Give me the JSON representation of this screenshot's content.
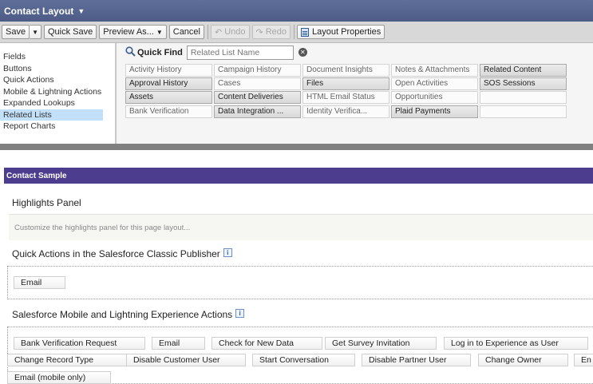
{
  "header": {
    "title": "Contact Layout"
  },
  "toolbar": {
    "save": "Save",
    "quick_save": "Quick Save",
    "preview_as": "Preview As...",
    "cancel": "Cancel",
    "undo": "Undo",
    "redo": "Redo",
    "layout_properties": "Layout Properties"
  },
  "palette": {
    "categories": [
      "Fields",
      "Buttons",
      "Quick Actions",
      "Mobile & Lightning Actions",
      "Expanded Lookups",
      "Related Lists",
      "Report Charts"
    ],
    "selected_category": "Related Lists",
    "quick_find": {
      "label": "Quick Find",
      "placeholder": "Related List Name"
    },
    "items": [
      [
        "Activity History",
        "Campaign History",
        "Document Insights",
        "Notes & Attachments",
        "Related Content"
      ],
      [
        "Approval History",
        "Cases",
        "Files",
        "Open Activities",
        "SOS Sessions"
      ],
      [
        "Assets",
        "Content Deliveries",
        "HTML Email Status",
        "Opportunities",
        ""
      ],
      [
        "Bank Verification",
        "Data Integration ...",
        "Identity Verifica...",
        "Plaid Payments",
        ""
      ]
    ],
    "active_items": [
      [
        false,
        false,
        false,
        false,
        true
      ],
      [
        true,
        false,
        true,
        false,
        true
      ],
      [
        true,
        true,
        false,
        false,
        false
      ],
      [
        false,
        true,
        false,
        true,
        false
      ]
    ]
  },
  "sample": {
    "bar_title": "Contact Sample",
    "highlights_title": "Highlights Panel",
    "highlights_hint": "Customize the highlights panel for this page layout...",
    "classic_title": "Quick Actions in the Salesforce Classic Publisher",
    "classic_actions": [
      "Email"
    ],
    "mobile_title": "Salesforce Mobile and Lightning Experience Actions",
    "mobile_actions": [
      [
        "Bank Verification Request",
        "Email",
        "Check for New Data",
        "Get Survey Invitation",
        "Log in to Experience as User",
        ""
      ],
      [
        "Change Record Type",
        "Disable Customer User",
        "Start Conversation",
        "Disable Partner User",
        "Change Owner",
        "En"
      ],
      [
        "Email (mobile only)"
      ]
    ]
  },
  "colors": {
    "title_bar": "#4c5c86",
    "sample_bar": "#4d3d8e",
    "selected_category": "#c2e0f9"
  }
}
